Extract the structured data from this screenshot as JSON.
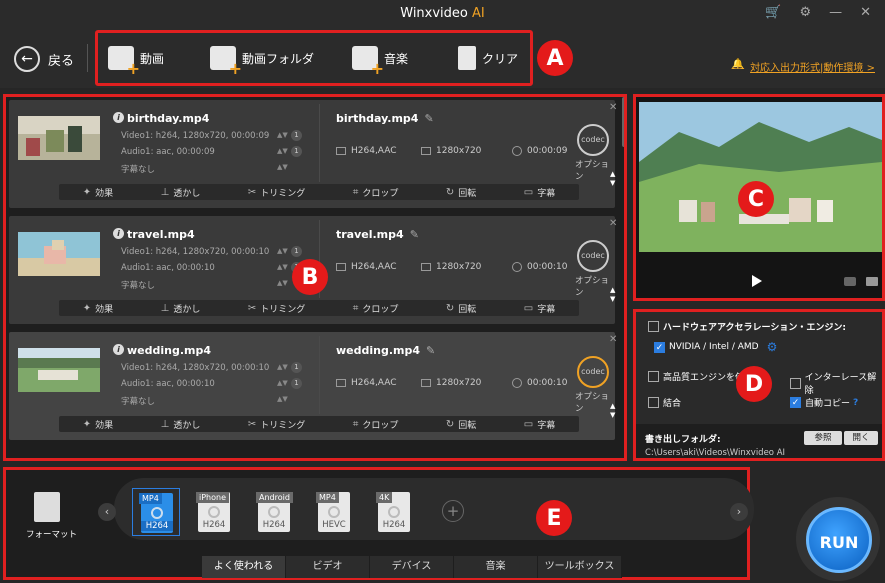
{
  "app": {
    "title": "Winxvideo",
    "title_suffix": "AI"
  },
  "toolbar": {
    "back_label": "戻る",
    "video_label": "動画",
    "video_folder_label": "動画フォルダ",
    "music_label": "音楽",
    "clear_label": "クリア",
    "support_link": "対応入出力形式|動作環境 >"
  },
  "badges": {
    "a": "A",
    "b": "B",
    "c": "C",
    "d": "D",
    "e": "E"
  },
  "files": [
    {
      "name": "birthday.mp4",
      "video": "Video1: h264, 1280x720, 00:00:09",
      "audio": "Audio1: aac, 00:00:09",
      "subtitle": "字幕なし",
      "video_count": "1",
      "audio_count": "1",
      "out_name": "birthday.mp4",
      "codec": "H264,AAC",
      "resolution": "1280x720",
      "duration": "00:00:09"
    },
    {
      "name": "travel.mp4",
      "video": "Video1: h264, 1280x720, 00:00:10",
      "audio": "Audio1: aac, 00:00:10",
      "subtitle": "字幕なし",
      "video_count": "1",
      "audio_count": "1",
      "out_name": "travel.mp4",
      "codec": "H264,AAC",
      "resolution": "1280x720",
      "duration": "00:00:10"
    },
    {
      "name": "wedding.mp4",
      "video": "Video1: h264, 1280x720, 00:00:10",
      "audio": "Audio1: aac, 00:00:10",
      "subtitle": "字幕なし",
      "video_count": "1",
      "audio_count": "1",
      "out_name": "wedding.mp4",
      "codec": "H264,AAC",
      "resolution": "1280x720",
      "duration": "00:00:10"
    }
  ],
  "card_labels": {
    "codec_icon": "codec",
    "option": "オプション",
    "effect": "効果",
    "watermark": "透かし",
    "trim": "トリミング",
    "crop": "クロップ",
    "rotate": "回転",
    "subtitle": "字幕"
  },
  "settings": {
    "hw_accel": "ハードウェアアクセラレーション・エンジン:",
    "gpu": "NVIDIA / Intel / AMD",
    "hq_engine": "高品質エンジンを使う",
    "deinterlace": "インターレース解除",
    "merge": "結合",
    "auto_copy": "自動コピー",
    "auto_copy_help": "?",
    "output_folder_label": "書き出しフォルダ:",
    "output_path": "C:\\Users\\aki\\Videos\\Winxvideo AI",
    "browse": "参照",
    "open": "開く"
  },
  "formats": {
    "panel_label": "フォーマット",
    "items": [
      {
        "tag": "MP4",
        "codec": "H264",
        "selected": true
      },
      {
        "tag": "iPhone",
        "codec": "H264",
        "selected": false
      },
      {
        "tag": "Android",
        "codec": "H264",
        "selected": false
      },
      {
        "tag": "MP4",
        "codec": "HEVC",
        "selected": false
      },
      {
        "tag": "4K",
        "codec": "H264",
        "selected": false
      }
    ],
    "tabs": [
      "よく使われる",
      "ビデオ",
      "デバイス",
      "音楽",
      "ツールボックス"
    ]
  },
  "run_label": "RUN",
  "colors": {
    "accent": "#f0a224",
    "highlight": "#e02020",
    "blue": "#2b7de0"
  }
}
